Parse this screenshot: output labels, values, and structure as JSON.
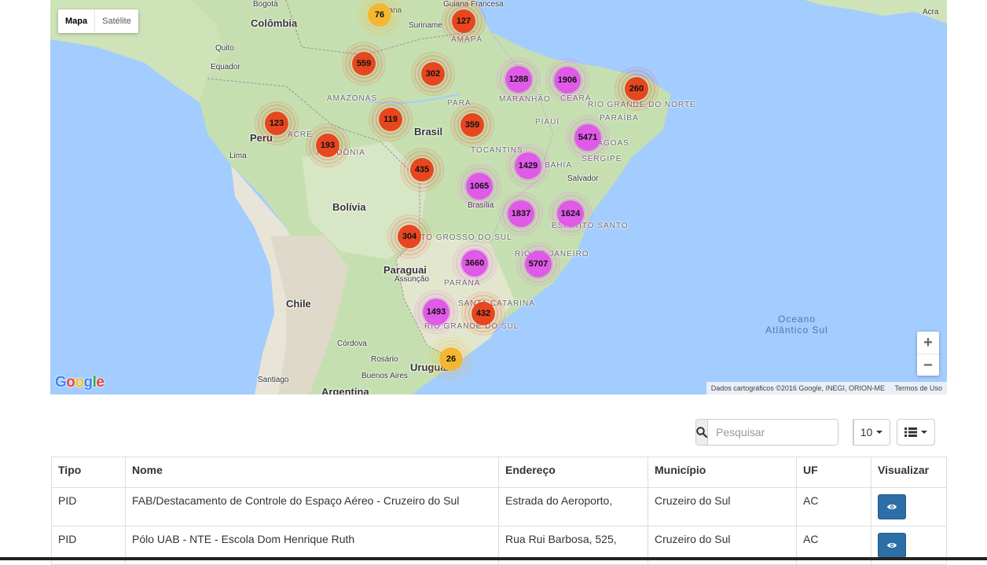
{
  "map": {
    "type_control": {
      "map_label": "Mapa",
      "satellite_label": "Satélite"
    },
    "zoom": {
      "in": "+",
      "out": "−"
    },
    "credits": {
      "data": "Dados cartográficos ©2016 Google, INEGI, ORION-ME",
      "terms": "Termos de Uso"
    },
    "logo": "Google",
    "labels": [
      {
        "text": "Bogotá",
        "kind": "city"
      },
      {
        "text": "Colômbia",
        "kind": "country"
      },
      {
        "text": "Quito",
        "kind": "city"
      },
      {
        "text": "Equador",
        "kind": "city"
      },
      {
        "text": "Guiana",
        "kind": "city"
      },
      {
        "text": "Suriname",
        "kind": "city"
      },
      {
        "text": "Guiana Francesa",
        "kind": "city"
      },
      {
        "text": "AMAPÁ",
        "kind": "state"
      },
      {
        "text": "AMAZONAS",
        "kind": "state"
      },
      {
        "text": "PARÁ",
        "kind": "state"
      },
      {
        "text": "MARANHÃO",
        "kind": "state"
      },
      {
        "text": "CEARÁ",
        "kind": "state"
      },
      {
        "text": "RIO GRANDE DO NORTE",
        "kind": "state"
      },
      {
        "text": "PARAÍBA",
        "kind": "state"
      },
      {
        "text": "PIAUÍ",
        "kind": "state"
      },
      {
        "text": "Brasil",
        "kind": "country"
      },
      {
        "text": "Peru",
        "kind": "country"
      },
      {
        "text": "ACRE",
        "kind": "state"
      },
      {
        "text": "RONDÔNIA",
        "kind": "state"
      },
      {
        "text": "TOCANTINS",
        "kind": "state"
      },
      {
        "text": "BAHIA",
        "kind": "state"
      },
      {
        "text": "ALAGOAS",
        "kind": "state"
      },
      {
        "text": "SERGIPE",
        "kind": "state"
      },
      {
        "text": "Lima",
        "kind": "city"
      },
      {
        "text": "Salvador",
        "kind": "city"
      },
      {
        "text": "Brasília",
        "kind": "city"
      },
      {
        "text": "Bolívia",
        "kind": "country"
      },
      {
        "text": "ESPÍRITO SANTO",
        "kind": "state"
      },
      {
        "text": "MATO GROSSO DO SUL",
        "kind": "state"
      },
      {
        "text": "RIO DE JANEIRO",
        "kind": "state"
      },
      {
        "text": "Paraguai",
        "kind": "country"
      },
      {
        "text": "Assunção",
        "kind": "city"
      },
      {
        "text": "PARANÁ",
        "kind": "state"
      },
      {
        "text": "Chile",
        "kind": "country"
      },
      {
        "text": "SANTA CATARINA",
        "kind": "state"
      },
      {
        "text": "RIO GRANDE DO SUL",
        "kind": "state"
      },
      {
        "text": "Córdova",
        "kind": "city"
      },
      {
        "text": "Rosário",
        "kind": "city"
      },
      {
        "text": "Uruguai",
        "kind": "country"
      },
      {
        "text": "Buenos Aires",
        "kind": "city"
      },
      {
        "text": "Santiago",
        "kind": "city"
      },
      {
        "text": "Argentina",
        "kind": "country"
      },
      {
        "text": "Oceano Atlântico Sul",
        "kind": "ocean"
      },
      {
        "text": "Acra",
        "kind": "city"
      }
    ],
    "clusters": [
      {
        "count": "76",
        "color": "#f5b731"
      },
      {
        "count": "127",
        "color": "#e8461e"
      },
      {
        "count": "559",
        "color": "#e8461e"
      },
      {
        "count": "302",
        "color": "#e8461e"
      },
      {
        "count": "1288",
        "color": "#e05ae8"
      },
      {
        "count": "1906",
        "color": "#e05ae8"
      },
      {
        "count": "260",
        "color": "#e8461e"
      },
      {
        "count": "123",
        "color": "#e8461e"
      },
      {
        "count": "119",
        "color": "#e8461e"
      },
      {
        "count": "359",
        "color": "#e8461e"
      },
      {
        "count": "193",
        "color": "#e8461e"
      },
      {
        "count": "5471",
        "color": "#e05ae8"
      },
      {
        "count": "1429",
        "color": "#e05ae8"
      },
      {
        "count": "435",
        "color": "#e8461e"
      },
      {
        "count": "1065",
        "color": "#e05ae8"
      },
      {
        "count": "1837",
        "color": "#e05ae8"
      },
      {
        "count": "1624",
        "color": "#e05ae8"
      },
      {
        "count": "304",
        "color": "#e8461e"
      },
      {
        "count": "3660",
        "color": "#e05ae8"
      },
      {
        "count": "5707",
        "color": "#e05ae8"
      },
      {
        "count": "1493",
        "color": "#e05ae8"
      },
      {
        "count": "432",
        "color": "#e8461e"
      },
      {
        "count": "26",
        "color": "#f5b731"
      }
    ]
  },
  "toolbar": {
    "search_placeholder": "Pesquisar",
    "page_size": "10",
    "search_icon": "search-icon",
    "columns_icon": "list-icon"
  },
  "table": {
    "headers": [
      "Tipo",
      "Nome",
      "Endereço",
      "Município",
      "UF",
      "Visualizar"
    ],
    "rows": [
      {
        "tipo": "PID",
        "nome": "FAB/Destacamento de Controle do Espaço Aéreo - Cruzeiro do Sul",
        "endereco": "Estrada do Aeroporto,",
        "municipio": "Cruzeiro do Sul",
        "uf": "AC"
      },
      {
        "tipo": "PID",
        "nome": "Pólo UAB - NTE - Escola Dom Henrique Ruth",
        "endereco": "Rua Rui Barbosa, 525,",
        "municipio": "Cruzeiro do Sul",
        "uf": "AC"
      }
    ],
    "action_icon": "eye-icon"
  }
}
